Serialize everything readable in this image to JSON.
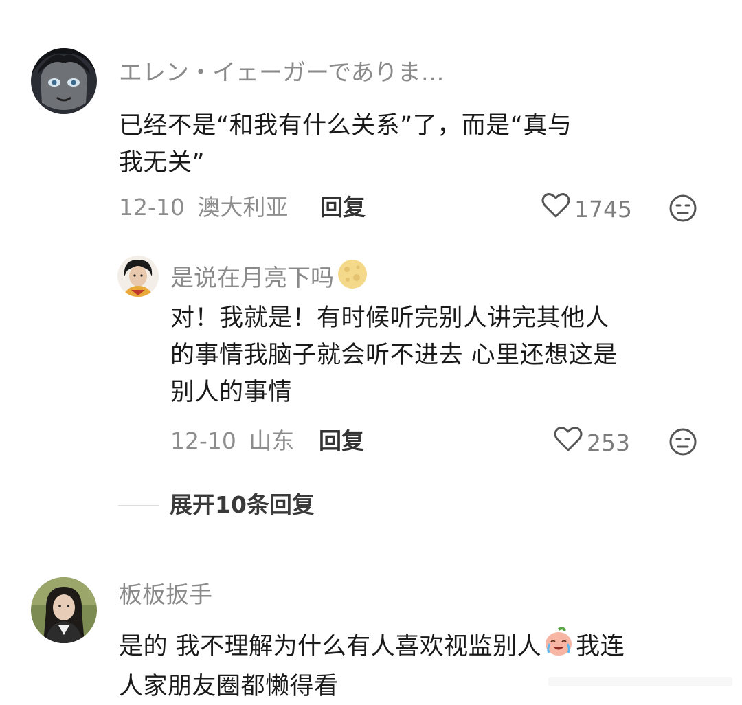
{
  "comments": [
    {
      "user": "エレン・イェーガーでありま…",
      "text_lines": [
        "已经不是“和我有什么关系”了，而是“真与",
        "我无关”"
      ],
      "date": "12-10",
      "location": "澳大利亚",
      "reply_label": "回复",
      "likes": "1745",
      "replies": [
        {
          "user": "是说在月亮下吗",
          "text_lines": [
            "对！我就是！有时候听完别人讲完其他人",
            "的事情我脑子就会听不进去 心里还想这是",
            "别人的事情"
          ],
          "date": "12-10",
          "location": "山东",
          "reply_label": "回复",
          "likes": "253"
        }
      ],
      "expand_label": "展开10条回复"
    },
    {
      "user": "板板扳手",
      "text_lines": [
        "是的 我不理解为什么有人喜欢视监别人",
        "我连",
        "人家朋友圈都懒得看"
      ]
    }
  ],
  "icons": {
    "like": "heart-outline-icon",
    "dislike": "neutral-face-icon",
    "name_emoji": "full-moon-icon",
    "text_emoji": "crying-laughing-peach-icon"
  },
  "colors": {
    "username": "#8a8a8a",
    "body_text": "#1a1a1a",
    "meta": "#8d8d8d"
  }
}
